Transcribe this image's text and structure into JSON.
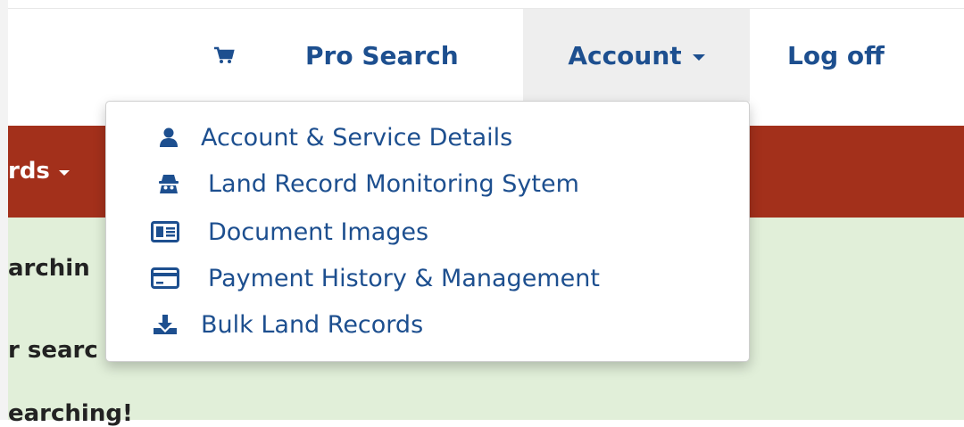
{
  "colors": {
    "nav_text": "#1d4f8f",
    "header_band": "#a3301b",
    "content_bg": "#e1efd9",
    "active_tab_bg": "#eeeeee"
  },
  "topnav": {
    "cart_icon": "shopping-cart-icon",
    "pro_search": "Pro Search",
    "account": "Account",
    "log_off": "Log off"
  },
  "red_band": {
    "partial_label": "rds"
  },
  "content": {
    "line1": "archin",
    "line2": "r searc",
    "line3": "earching!"
  },
  "account_menu": {
    "items": [
      {
        "label": "Account & Service Details",
        "icon": "user-icon"
      },
      {
        "label": "Land Record Monitoring Sytem",
        "icon": "spy-icon"
      },
      {
        "label": "Document Images",
        "icon": "id-card-icon"
      },
      {
        "label": "Payment History & Management",
        "icon": "credit-card-icon"
      },
      {
        "label": "Bulk Land Records",
        "icon": "download-icon"
      }
    ]
  }
}
